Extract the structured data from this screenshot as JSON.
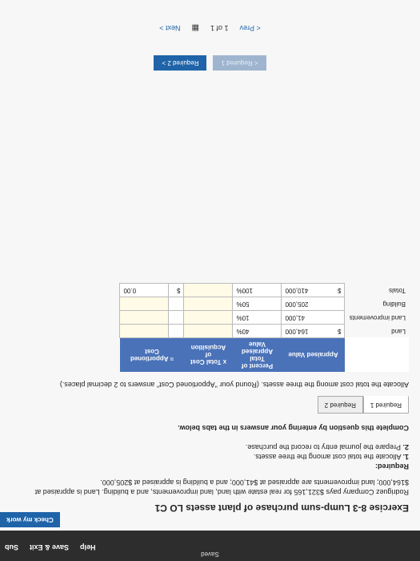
{
  "header": {
    "saved": "Saved",
    "help": "Help",
    "save_exit": "Save & Exit",
    "submit": "Sub",
    "check": "Check my work"
  },
  "exercise": {
    "title": "Exercise 8-3 Lump-sum purchase of plant assets LO C1",
    "intro": "Rodriguez Company pays $321,165 for real estate with land, land improvements, and a building. Land is appraised at $164,000; land improvements are appraised at $41,000; and a building is appraised at $205,000.",
    "required_head": "Required:",
    "req1_num": "1.",
    "req1": "Allocate the total cost among the three assets.",
    "req2_num": "2.",
    "req2": "Prepare the journal entry to record the purchase."
  },
  "complete_text": "Complete this question by entering your answers in the tabs below.",
  "tabs": {
    "t1": "Required 1",
    "t2": "Required 2"
  },
  "instruction": "Allocate the total cost among the three assets. (Round your \"Apportioned Cost\" answers to 2 decimal places.)",
  "table": {
    "h_appraised": "Appraised Value",
    "h_percent": "Percent of Total Appraised Value",
    "h_total": "x  Total Cost of Acquisition",
    "h_apportioned": "= Apportioned Cost",
    "rows": [
      {
        "label": "Land",
        "dollar": "$",
        "value": "164,000",
        "pct": "40%",
        "total": "",
        "app": ""
      },
      {
        "label": "Land improvements",
        "dollar": "",
        "value": "41,000",
        "pct": "10%",
        "total": "",
        "app": ""
      },
      {
        "label": "Building",
        "dollar": "",
        "value": "205,000",
        "pct": "50%",
        "total": "",
        "app": ""
      },
      {
        "label": "Totals",
        "dollar": "$",
        "value": "410,000",
        "pct": "100%",
        "total": "",
        "app_dollar": "$",
        "app": "0.00"
      }
    ]
  },
  "nav": {
    "prev_btn": "< Required 1",
    "next_btn": "Required 2  >"
  },
  "pager": {
    "prev": "< Prev",
    "pos": "1 of 1",
    "next": "Next >"
  }
}
